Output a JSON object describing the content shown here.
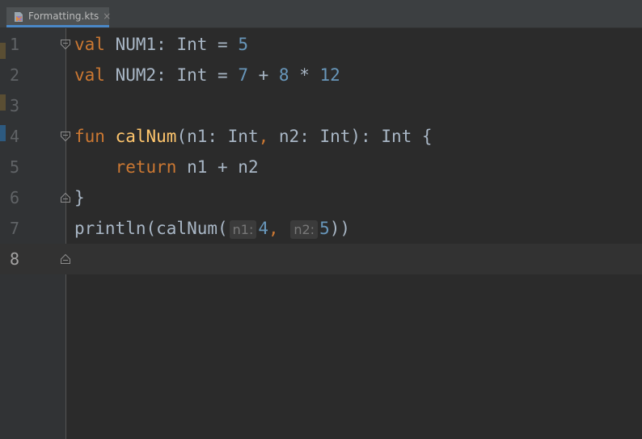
{
  "tab": {
    "title": "Formatting.kts",
    "close": "×"
  },
  "line_numbers": [
    "1",
    "2",
    "3",
    "4",
    "5",
    "6",
    "7",
    "8"
  ],
  "code": {
    "l1": {
      "kw": "val",
      "rest1": " NUM1: Int = ",
      "n1": "5"
    },
    "l2": {
      "kw": "val",
      "rest1": " NUM2: Int = ",
      "n1": "7",
      "op1": " + ",
      "n2": "8",
      "op2": " * ",
      "n3": "12"
    },
    "l4": {
      "kw": "fun",
      "sp": " ",
      "name": "calNum",
      "p1": "(n1: Int",
      "comma": ",",
      "p2": " n2: Int): Int {"
    },
    "l5": {
      "indent": "    ",
      "kw": "return",
      "rest": " n1 + n2"
    },
    "l6": {
      "text": "}"
    },
    "l7": {
      "call": "println(calNum(",
      "hint1": "n1:",
      "a1": "4",
      "comma": ",",
      "hint2": "n2:",
      "a2": "5",
      "close": "))"
    }
  },
  "colors": {
    "keyword": "#cc7832",
    "number": "#6897bb",
    "function": "#ffc66d",
    "text": "#a9b7c6",
    "background": "#2b2b2b"
  },
  "icons": {
    "file": "kotlin-script-file-icon",
    "fold": "fold-marker-icon"
  }
}
